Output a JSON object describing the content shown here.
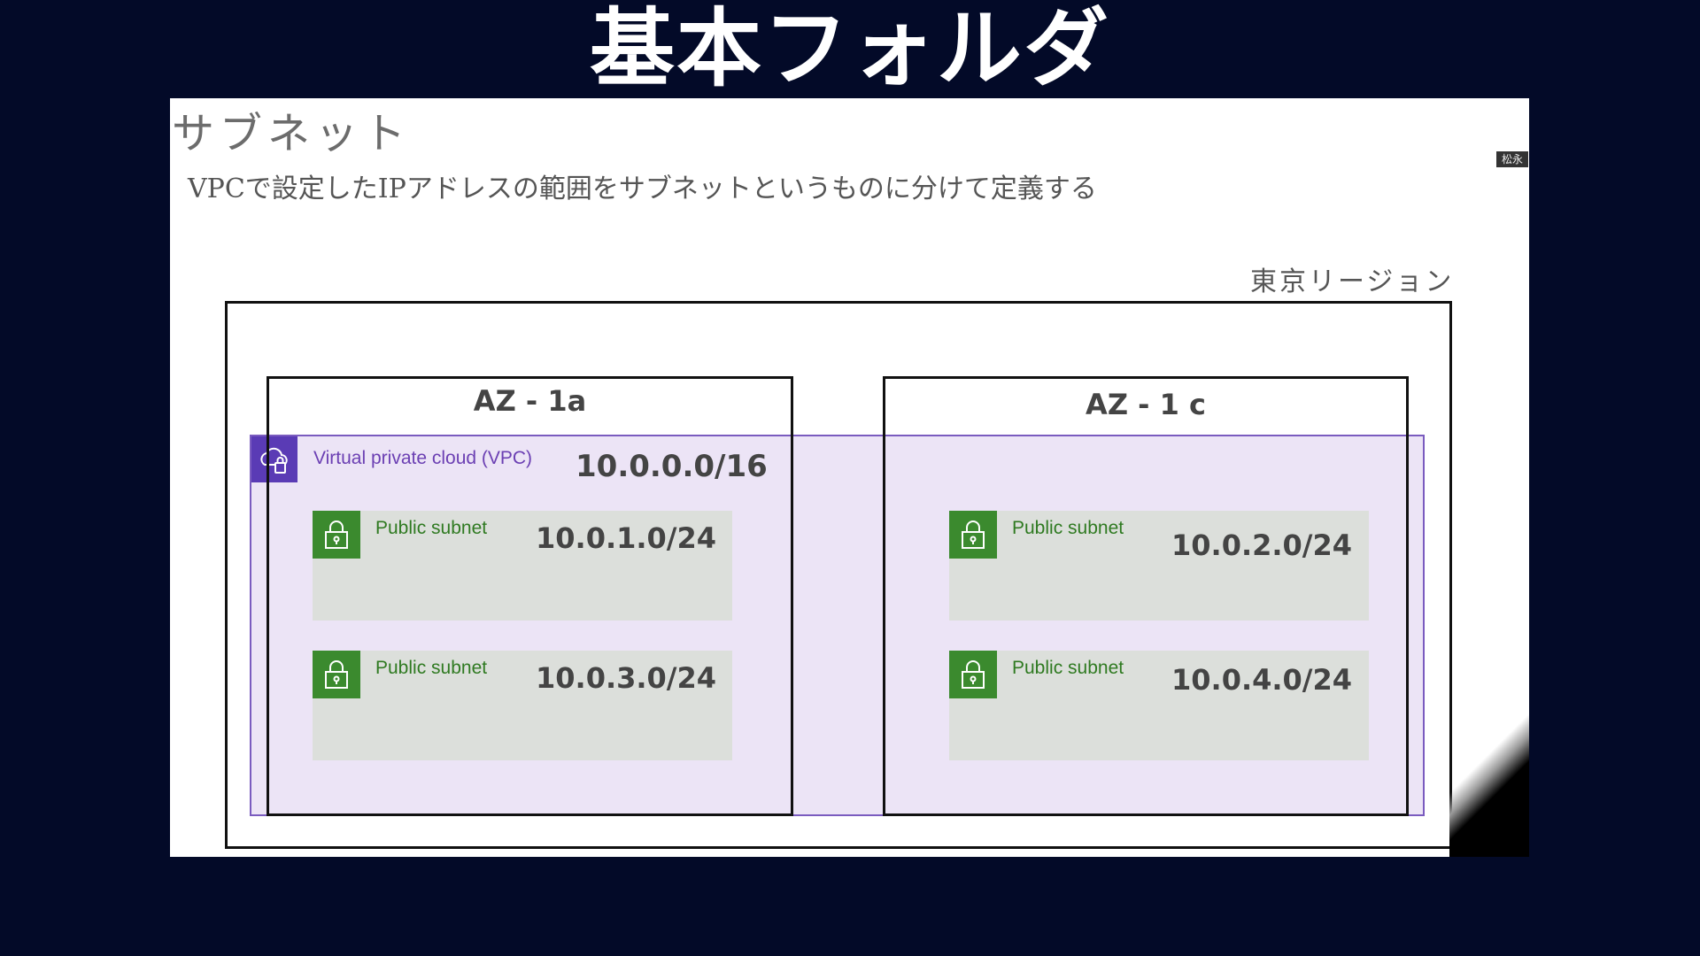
{
  "banner": {
    "title": "基本フォルダ"
  },
  "slide": {
    "title": "サブネット",
    "subtitle": "VPCで設定したIPアドレスの範囲をサブネットというものに分けて定義する",
    "corner_tag": "松永",
    "region_label": "東京リージョン"
  },
  "az": [
    {
      "label": "AZ - 1a"
    },
    {
      "label": "AZ - 1 c"
    }
  ],
  "vpc": {
    "label": "Virtual private cloud (VPC)",
    "cidr": "10.0.0.0/16",
    "icon": "vpc-cloud-lock-icon",
    "color": "#5a3bb5"
  },
  "subnets": [
    {
      "label": "Public subnet",
      "cidr": "10.0.1.0/24"
    },
    {
      "label": "Public subnet",
      "cidr": "10.0.2.0/24"
    },
    {
      "label": "Public subnet",
      "cidr": "10.0.3.0/24"
    },
    {
      "label": "Public subnet",
      "cidr": "10.0.4.0/24"
    }
  ],
  "subnet_icon": "lock-icon",
  "subnet_color": "#3b8a2e"
}
